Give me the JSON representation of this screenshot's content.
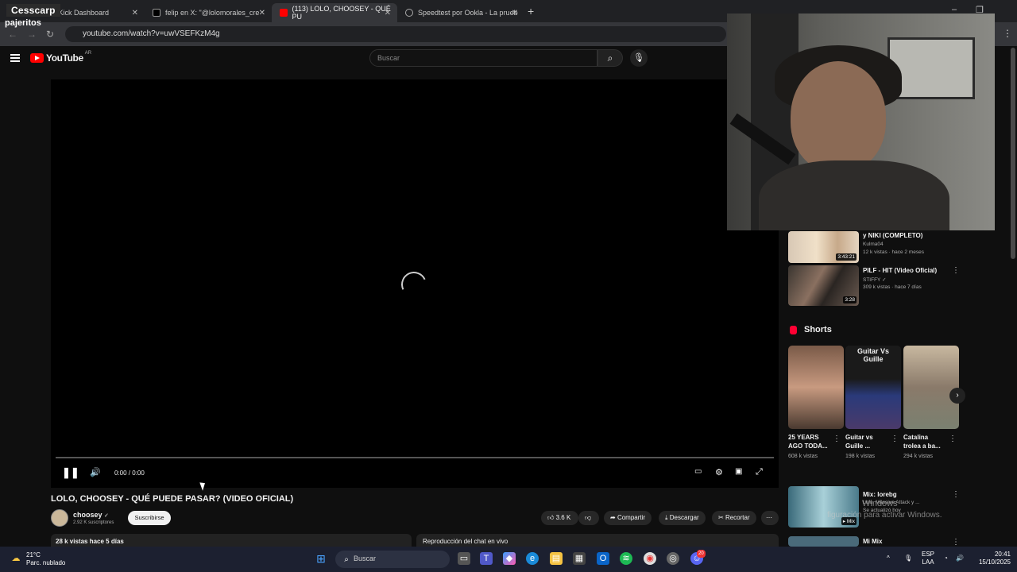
{
  "stream_overlay": {
    "streamer": "Cesscarp",
    "subtitle": "pajeritos"
  },
  "browser": {
    "tabs": [
      {
        "label": "- Kick Dashboard",
        "active": false
      },
      {
        "label": "felip en X: \"@lolomorales_cre",
        "active": false
      },
      {
        "label": "(113) LOLO, CHOOSEY - QUÉ PU",
        "active": true
      },
      {
        "label": "Speedtest por Ookla - La prueb",
        "active": false
      }
    ],
    "url": "youtube.com/watch?v=uwVSEFKzM4g"
  },
  "youtube": {
    "logo_text": "YouTube",
    "country_code": "AR",
    "search_placeholder": "Buscar"
  },
  "player": {
    "time": "0:00 / 0:00",
    "progress_fraction": 0
  },
  "video": {
    "title": "LOLO, CHOOSEY - QUÉ PUEDE PASAR? (VIDEO OFICIAL)",
    "channel": "choosey",
    "subscribers": "2.92 K suscriptores",
    "subscribe_label": "Suscribirse",
    "likes": "3.6 K",
    "share_label": "Compartir",
    "download_label": "Descargar",
    "clip_label": "Recortar",
    "views_date": "28 k vistas  hace 5 días",
    "chat_label": "Reproducción del chat en vivo"
  },
  "sidebar": {
    "videos": [
      {
        "title": "y NIKI (COMPLETO)",
        "channel": "Kulma04",
        "meta": "12 k vistas · hace 2 meses",
        "duration": "3:43:21"
      },
      {
        "title": "PILF - HIT (Video Oficial)",
        "channel": "STIFFY",
        "meta": "309 k vistas · hace 7 días",
        "duration": "3:28"
      }
    ],
    "shorts_heading": "Shorts",
    "shorts": [
      {
        "title": "25 YEARS AGO TODA...",
        "views": "608 k vistas"
      },
      {
        "title": "Guitar vs Guille ...",
        "views": "198 k vistas"
      },
      {
        "title": "Catalina trolea a ba...",
        "views": "294 k vistas"
      }
    ],
    "short_overlay_text": "Guitar Vs Guille",
    "mixes": [
      {
        "title": "Mix: lorebg",
        "meta": "Lolo, Massive Attack y ...",
        "meta2": "Se actualizó hoy",
        "badge": "Mix"
      },
      {
        "title": "Mi Mix"
      }
    ]
  },
  "windows_activation": {
    "line1": "Windows",
    "line2": "figuración para activar Windows."
  },
  "taskbar": {
    "temperature": "21°C",
    "weather": "Parc. nublado",
    "search_label": "Buscar",
    "language": "ESP",
    "region": "LAA",
    "time": "20:41",
    "date": "15/10/2025",
    "discord_badge": "20"
  }
}
